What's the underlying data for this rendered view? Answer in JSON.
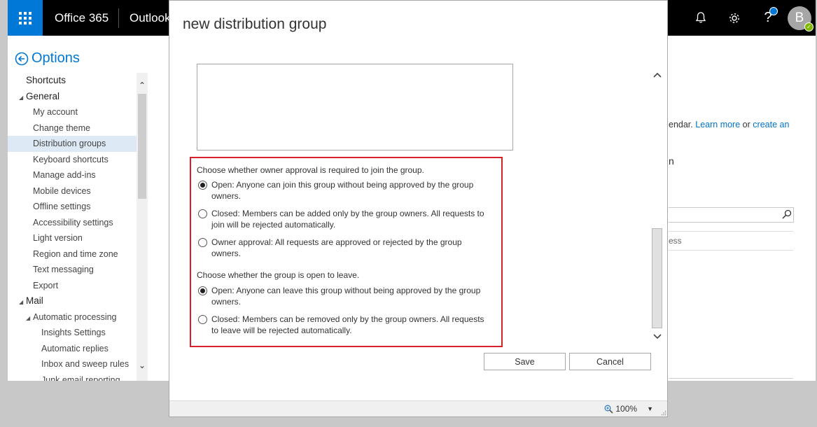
{
  "header": {
    "brand": "Office 365",
    "app": "Outlook",
    "avatar_initial": "B"
  },
  "options": {
    "title": "Options"
  },
  "nav": {
    "items": [
      {
        "label": "Shortcuts",
        "level": 0,
        "type": "head"
      },
      {
        "label": "General",
        "level": 0,
        "type": "head",
        "expanded": true
      },
      {
        "label": "My account",
        "level": 1
      },
      {
        "label": "Change theme",
        "level": 1
      },
      {
        "label": "Distribution groups",
        "level": 1,
        "selected": true
      },
      {
        "label": "Keyboard shortcuts",
        "level": 1
      },
      {
        "label": "Manage add-ins",
        "level": 1
      },
      {
        "label": "Mobile devices",
        "level": 1
      },
      {
        "label": "Offline settings",
        "level": 1
      },
      {
        "label": "Accessibility settings",
        "level": 1
      },
      {
        "label": "Light version",
        "level": 1
      },
      {
        "label": "Region and time zone",
        "level": 1
      },
      {
        "label": "Text messaging",
        "level": 1
      },
      {
        "label": "Export",
        "level": 1
      },
      {
        "label": "Mail",
        "level": 0,
        "type": "head",
        "expanded": true
      },
      {
        "label": "Automatic processing",
        "level": 1,
        "expanded": true
      },
      {
        "label": "Insights Settings",
        "level": 2
      },
      {
        "label": "Automatic replies",
        "level": 2
      },
      {
        "label": "Inbox and sweep rules",
        "level": 2
      },
      {
        "label": "Junk email reporting",
        "level": 2
      }
    ]
  },
  "background": {
    "fragment_text": "endar.",
    "learn_more": "Learn more",
    "or": "or",
    "create_an": "create an",
    "fragment_n": "n",
    "column_fragment": "ess"
  },
  "dialog": {
    "title": "new distribution group",
    "join_label": "Choose whether owner approval is required to join the group.",
    "join_options": [
      {
        "label": "Open: Anyone can join this group without being approved by the group owners.",
        "checked": true
      },
      {
        "label": "Closed: Members can be added only by the group owners. All requests to join will be rejected automatically.",
        "checked": false
      },
      {
        "label": "Owner approval: All requests are approved or rejected by the group owners.",
        "checked": false
      }
    ],
    "leave_label": "Choose whether the group is open to leave.",
    "leave_options": [
      {
        "label": "Open: Anyone can leave this group without being approved by the group owners.",
        "checked": true
      },
      {
        "label": "Closed: Members can be removed only by the group owners. All requests to leave will be rejected automatically.",
        "checked": false
      }
    ],
    "save_label": "Save",
    "cancel_label": "Cancel",
    "zoom": "100%"
  },
  "colors": {
    "accent": "#0078d7",
    "highlight": "#d6202c",
    "topbar": "#000000"
  }
}
